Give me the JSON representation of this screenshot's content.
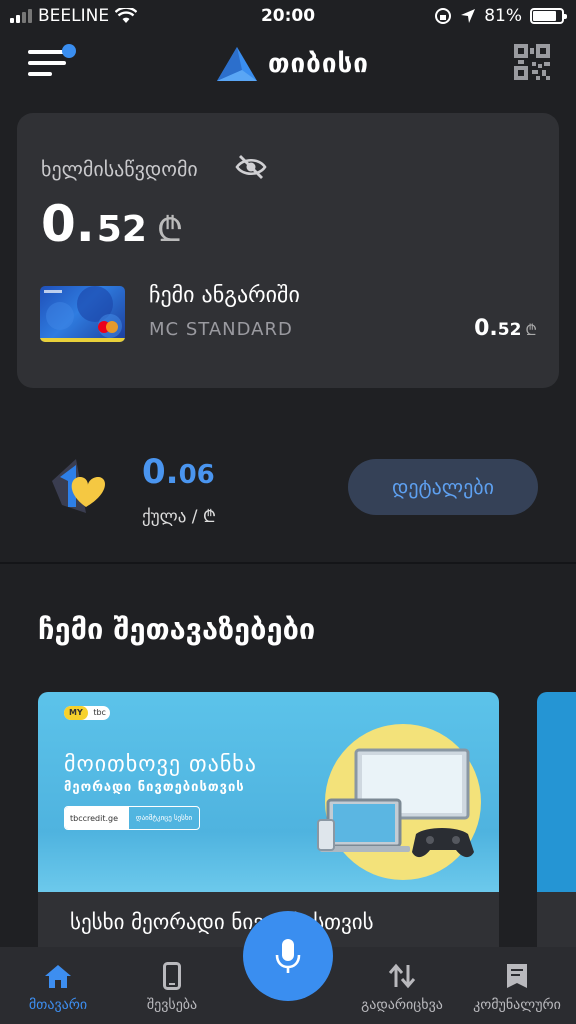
{
  "status_bar": {
    "carrier": "BEELINE",
    "time": "20:00",
    "battery": "81%",
    "battery_level": 0.81
  },
  "header": {
    "logo_text": "თიბისი",
    "icons": {
      "menu": "hamburger-menu-icon",
      "qr": "qr-code-icon"
    },
    "accent": "#3a8ef0"
  },
  "balance_card": {
    "label": "ხელმისაწვდომი",
    "amount_int": "0.",
    "amount_dec": "52",
    "currency": "₾",
    "account": {
      "name": "ჩემი ანგარიში",
      "type": "MC STANDARD",
      "amount_int": "0.",
      "amount_dec": "52",
      "currency": "₾"
    }
  },
  "points": {
    "value_int": "0.",
    "value_dec": "06",
    "label": "ქულა / ₾",
    "details_button": "დეტალები"
  },
  "offers": {
    "title": "ჩემი შეთავაზებები",
    "items": [
      {
        "badge": "MY",
        "badge_sub": "tbc",
        "banner_line1": "მოითხოვე თანხა",
        "banner_line2": "მეორადი ნივთებისთვის",
        "pill_left": "tbccredit.ge",
        "pill_right": "დაიმტკიცე სესხი",
        "caption": "სესხი მეორადი ნივთებისთვის"
      }
    ]
  },
  "tabbar": {
    "tabs": [
      {
        "label": "მთავარი",
        "icon": "home-icon",
        "active": true
      },
      {
        "label": "შევსება",
        "icon": "phone-icon",
        "active": false
      },
      {
        "label": "გადარიცხვა",
        "icon": "transfer-arrows-icon",
        "active": false
      },
      {
        "label": "კომუნალური",
        "icon": "bill-icon",
        "active": false
      }
    ],
    "mic_icon": "microphone-icon"
  }
}
